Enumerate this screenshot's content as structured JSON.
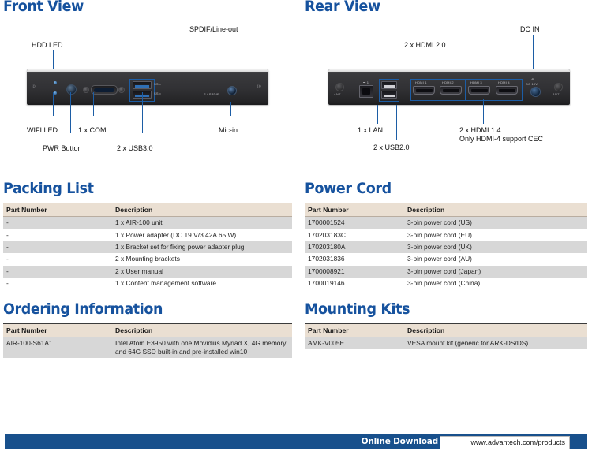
{
  "sections": {
    "front_view": {
      "title": "Front View"
    },
    "rear_view": {
      "title": "Rear View"
    },
    "packing_list": {
      "title": "Packing List"
    },
    "power_cord": {
      "title": "Power Cord"
    },
    "ordering_information": {
      "title": "Ordering Information"
    },
    "mounting_kits": {
      "title": "Mounting Kits"
    }
  },
  "front_view_callouts": {
    "hdd_led": "HDD LED",
    "spdif_lineout": "SPDIF/Line-out",
    "wifi_led": "WIFI LED",
    "com": "1 x COM",
    "pwr_button": "PWR Button",
    "usb30": "2 x USB3.0",
    "mic_in": "Mic-in"
  },
  "front_panel_markings": {
    "spdif": "S / SPDIF",
    "usb_ss_top": "SS⇐",
    "usb_ss_bottom": "SS⇐"
  },
  "rear_view_callouts": {
    "hdmi20": "2 x HDMI 2.0",
    "dc_in": "DC IN",
    "lan": "1 x LAN",
    "usb20": "2 x USB2.0",
    "hdmi14_line1": "2 x HDMI 1.4",
    "hdmi14_line2": "Only HDMI-4 support CEC"
  },
  "rear_panel_markings": {
    "ant_left": "ANT",
    "ant_right": "ANT",
    "lan_label": "⎓ 1",
    "hdmi1": "HDMI 1",
    "hdmi2": "HDMI 2",
    "hdmi3": "HDMI 3",
    "hdmi4": "HDMI 4",
    "dc_label": "DC 19V",
    "dc_polarity": "—⊕—"
  },
  "tables": {
    "columns": {
      "part_number": "Part Number",
      "description": "Description"
    },
    "packing_list": [
      {
        "part_number": "-",
        "description": "1 x AIR-100 unit"
      },
      {
        "part_number": "-",
        "description": "1 x Power adapter (DC 19 V/3.42A 65 W)"
      },
      {
        "part_number": "-",
        "description": "1 x Bracket set for fixing power adapter plug"
      },
      {
        "part_number": "-",
        "description": "2 x Mounting brackets"
      },
      {
        "part_number": "-",
        "description": "2 x User manual"
      },
      {
        "part_number": "-",
        "description": "1 x Content management software"
      }
    ],
    "power_cord": [
      {
        "part_number": "1700001524",
        "description": "3-pin power cord (US)"
      },
      {
        "part_number": "170203183C",
        "description": "3-pin power cord (EU)"
      },
      {
        "part_number": "170203180A",
        "description": "3-pin power cord (UK)"
      },
      {
        "part_number": "1702031836",
        "description": "3-pin power cord (AU)"
      },
      {
        "part_number": "1700008921",
        "description": "3-pin power cord (Japan)"
      },
      {
        "part_number": "1700019146",
        "description": "3-pin power cord (China)"
      }
    ],
    "ordering_information": [
      {
        "part_number": "AIR-100-S61A1",
        "description": "Intel Atom E3950 with one Movidius Myriad X, 4G memory and 64G SSD built-in and pre-installed win10"
      }
    ],
    "mounting_kits": [
      {
        "part_number": "AMK-V005E",
        "description": "VESA mount kit (generic for ARK-DS/DS)"
      }
    ]
  },
  "footer": {
    "label": "Online Download",
    "url": "www.advantech.com/products"
  },
  "colors": {
    "heading_blue": "#16529e",
    "footer_blue": "#18508c",
    "table_header_beige": "#eadfd2",
    "row_gray": "#d7d7d7",
    "callout_blue": "#1c5da5"
  }
}
